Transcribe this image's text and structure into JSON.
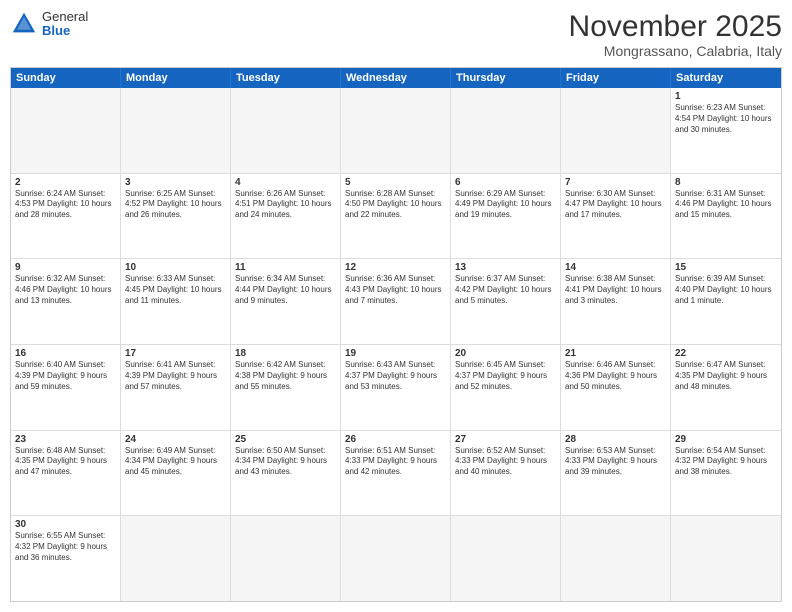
{
  "logo": {
    "general": "General",
    "blue": "Blue"
  },
  "title": "November 2025",
  "subtitle": "Mongrassano, Calabria, Italy",
  "days": [
    "Sunday",
    "Monday",
    "Tuesday",
    "Wednesday",
    "Thursday",
    "Friday",
    "Saturday"
  ],
  "weeks": [
    [
      {
        "day": "",
        "info": ""
      },
      {
        "day": "",
        "info": ""
      },
      {
        "day": "",
        "info": ""
      },
      {
        "day": "",
        "info": ""
      },
      {
        "day": "",
        "info": ""
      },
      {
        "day": "",
        "info": ""
      },
      {
        "day": "1",
        "info": "Sunrise: 6:23 AM\nSunset: 4:54 PM\nDaylight: 10 hours and 30 minutes."
      }
    ],
    [
      {
        "day": "2",
        "info": "Sunrise: 6:24 AM\nSunset: 4:53 PM\nDaylight: 10 hours and 28 minutes."
      },
      {
        "day": "3",
        "info": "Sunrise: 6:25 AM\nSunset: 4:52 PM\nDaylight: 10 hours and 26 minutes."
      },
      {
        "day": "4",
        "info": "Sunrise: 6:26 AM\nSunset: 4:51 PM\nDaylight: 10 hours and 24 minutes."
      },
      {
        "day": "5",
        "info": "Sunrise: 6:28 AM\nSunset: 4:50 PM\nDaylight: 10 hours and 22 minutes."
      },
      {
        "day": "6",
        "info": "Sunrise: 6:29 AM\nSunset: 4:49 PM\nDaylight: 10 hours and 19 minutes."
      },
      {
        "day": "7",
        "info": "Sunrise: 6:30 AM\nSunset: 4:47 PM\nDaylight: 10 hours and 17 minutes."
      },
      {
        "day": "8",
        "info": "Sunrise: 6:31 AM\nSunset: 4:46 PM\nDaylight: 10 hours and 15 minutes."
      }
    ],
    [
      {
        "day": "9",
        "info": "Sunrise: 6:32 AM\nSunset: 4:46 PM\nDaylight: 10 hours and 13 minutes."
      },
      {
        "day": "10",
        "info": "Sunrise: 6:33 AM\nSunset: 4:45 PM\nDaylight: 10 hours and 11 minutes."
      },
      {
        "day": "11",
        "info": "Sunrise: 6:34 AM\nSunset: 4:44 PM\nDaylight: 10 hours and 9 minutes."
      },
      {
        "day": "12",
        "info": "Sunrise: 6:36 AM\nSunset: 4:43 PM\nDaylight: 10 hours and 7 minutes."
      },
      {
        "day": "13",
        "info": "Sunrise: 6:37 AM\nSunset: 4:42 PM\nDaylight: 10 hours and 5 minutes."
      },
      {
        "day": "14",
        "info": "Sunrise: 6:38 AM\nSunset: 4:41 PM\nDaylight: 10 hours and 3 minutes."
      },
      {
        "day": "15",
        "info": "Sunrise: 6:39 AM\nSunset: 4:40 PM\nDaylight: 10 hours and 1 minute."
      }
    ],
    [
      {
        "day": "16",
        "info": "Sunrise: 6:40 AM\nSunset: 4:39 PM\nDaylight: 9 hours and 59 minutes."
      },
      {
        "day": "17",
        "info": "Sunrise: 6:41 AM\nSunset: 4:39 PM\nDaylight: 9 hours and 57 minutes."
      },
      {
        "day": "18",
        "info": "Sunrise: 6:42 AM\nSunset: 4:38 PM\nDaylight: 9 hours and 55 minutes."
      },
      {
        "day": "19",
        "info": "Sunrise: 6:43 AM\nSunset: 4:37 PM\nDaylight: 9 hours and 53 minutes."
      },
      {
        "day": "20",
        "info": "Sunrise: 6:45 AM\nSunset: 4:37 PM\nDaylight: 9 hours and 52 minutes."
      },
      {
        "day": "21",
        "info": "Sunrise: 6:46 AM\nSunset: 4:36 PM\nDaylight: 9 hours and 50 minutes."
      },
      {
        "day": "22",
        "info": "Sunrise: 6:47 AM\nSunset: 4:35 PM\nDaylight: 9 hours and 48 minutes."
      }
    ],
    [
      {
        "day": "23",
        "info": "Sunrise: 6:48 AM\nSunset: 4:35 PM\nDaylight: 9 hours and 47 minutes."
      },
      {
        "day": "24",
        "info": "Sunrise: 6:49 AM\nSunset: 4:34 PM\nDaylight: 9 hours and 45 minutes."
      },
      {
        "day": "25",
        "info": "Sunrise: 6:50 AM\nSunset: 4:34 PM\nDaylight: 9 hours and 43 minutes."
      },
      {
        "day": "26",
        "info": "Sunrise: 6:51 AM\nSunset: 4:33 PM\nDaylight: 9 hours and 42 minutes."
      },
      {
        "day": "27",
        "info": "Sunrise: 6:52 AM\nSunset: 4:33 PM\nDaylight: 9 hours and 40 minutes."
      },
      {
        "day": "28",
        "info": "Sunrise: 6:53 AM\nSunset: 4:33 PM\nDaylight: 9 hours and 39 minutes."
      },
      {
        "day": "29",
        "info": "Sunrise: 6:54 AM\nSunset: 4:32 PM\nDaylight: 9 hours and 38 minutes."
      }
    ],
    [
      {
        "day": "30",
        "info": "Sunrise: 6:55 AM\nSunset: 4:32 PM\nDaylight: 9 hours and 36 minutes."
      },
      {
        "day": "",
        "info": ""
      },
      {
        "day": "",
        "info": ""
      },
      {
        "day": "",
        "info": ""
      },
      {
        "day": "",
        "info": ""
      },
      {
        "day": "",
        "info": ""
      },
      {
        "day": "",
        "info": ""
      }
    ]
  ]
}
